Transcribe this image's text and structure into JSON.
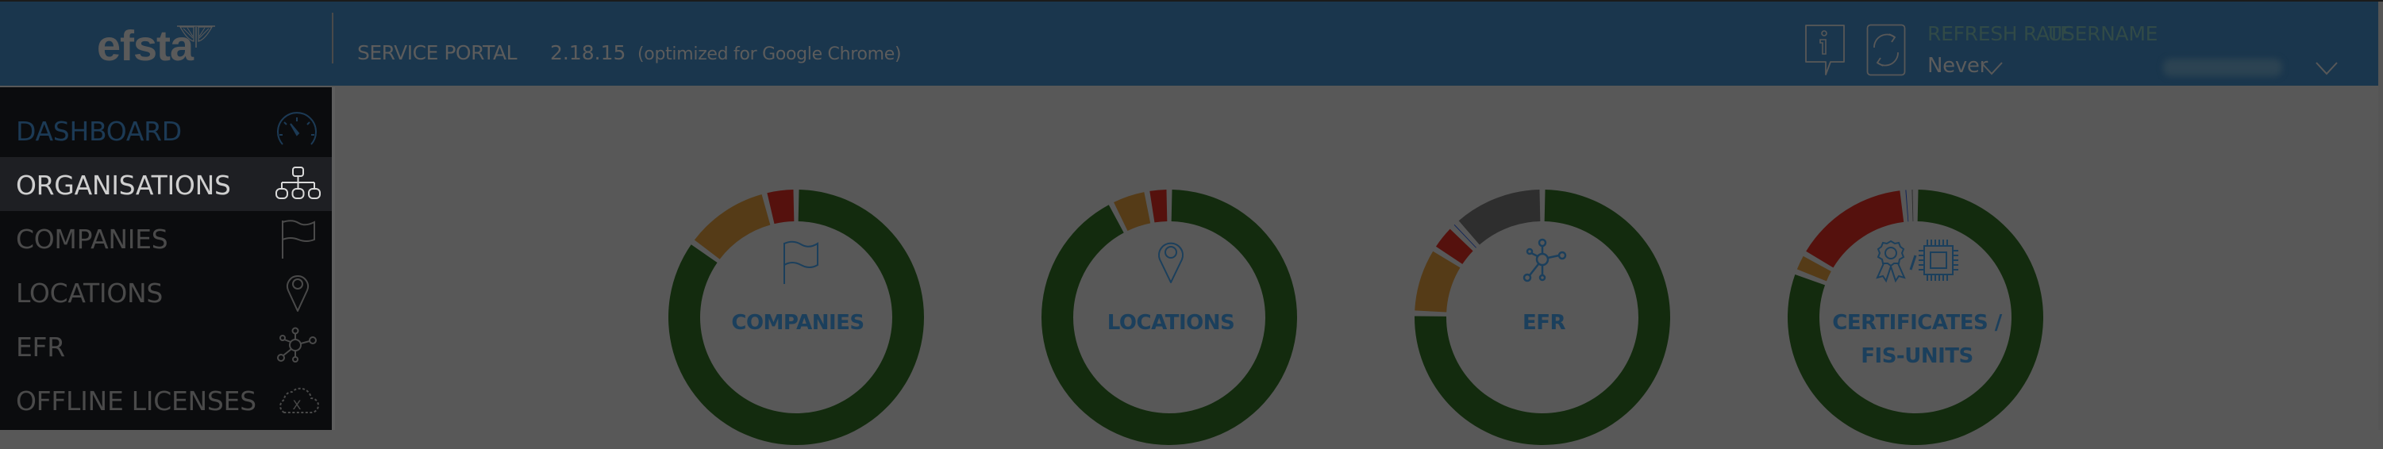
{
  "header": {
    "logo_text": "efsta",
    "portal_title": "SERVICE PORTAL",
    "version": "2.18.15",
    "note": "(optimized for Google Chrome)",
    "info_icon": "info-bubble-icon",
    "refresh_icon": "refresh-icon",
    "refresh_rate_label": "REFRESH RATE",
    "refresh_rate_value": "Never",
    "username_label": "USERNAME",
    "username_value": ""
  },
  "sidebar": {
    "items": [
      {
        "label": "DASHBOARD",
        "icon": "speedometer-icon",
        "state": "current"
      },
      {
        "label": "ORGANISATIONS",
        "icon": "org-chart-icon",
        "state": "active"
      },
      {
        "label": "COMPANIES",
        "icon": "flag-icon",
        "state": ""
      },
      {
        "label": "LOCATIONS",
        "icon": "map-pin-icon",
        "state": ""
      },
      {
        "label": "EFR",
        "icon": "network-hub-icon",
        "state": ""
      },
      {
        "label": "OFFLINE LICENSES",
        "icon": "cloud-x-icon",
        "state": ""
      }
    ]
  },
  "colors": {
    "green": "#132b0e",
    "orange": "#553b17",
    "red": "#55110d",
    "blue": "#0f2358",
    "gray": "#2e2e2e",
    "label": "#1b3f5c",
    "header_bg": "#1a364d"
  },
  "chart_data": [
    {
      "type": "pie",
      "title": "COMPANIES",
      "categories": [
        "green",
        "orange",
        "red"
      ],
      "values": [
        0.85,
        0.11,
        0.04
      ]
    },
    {
      "type": "pie",
      "title": "LOCATIONS",
      "categories": [
        "green",
        "orange",
        "red"
      ],
      "values": [
        0.925,
        0.047,
        0.028
      ]
    },
    {
      "type": "pie",
      "title": "EFR",
      "categories": [
        "green",
        "orange",
        "red",
        "blue",
        "gray"
      ],
      "values": [
        0.755,
        0.085,
        0.035,
        0.008,
        0.117
      ]
    },
    {
      "type": "pie",
      "title": "CERTIFICATES / FIS-UNITS",
      "title_lines": [
        "CERTIFICATES /",
        "FIS-UNITS"
      ],
      "categories": [
        "green",
        "orange",
        "red",
        "blue",
        "gray"
      ],
      "values": [
        0.808,
        0.025,
        0.151,
        0.008,
        0.008
      ]
    }
  ]
}
